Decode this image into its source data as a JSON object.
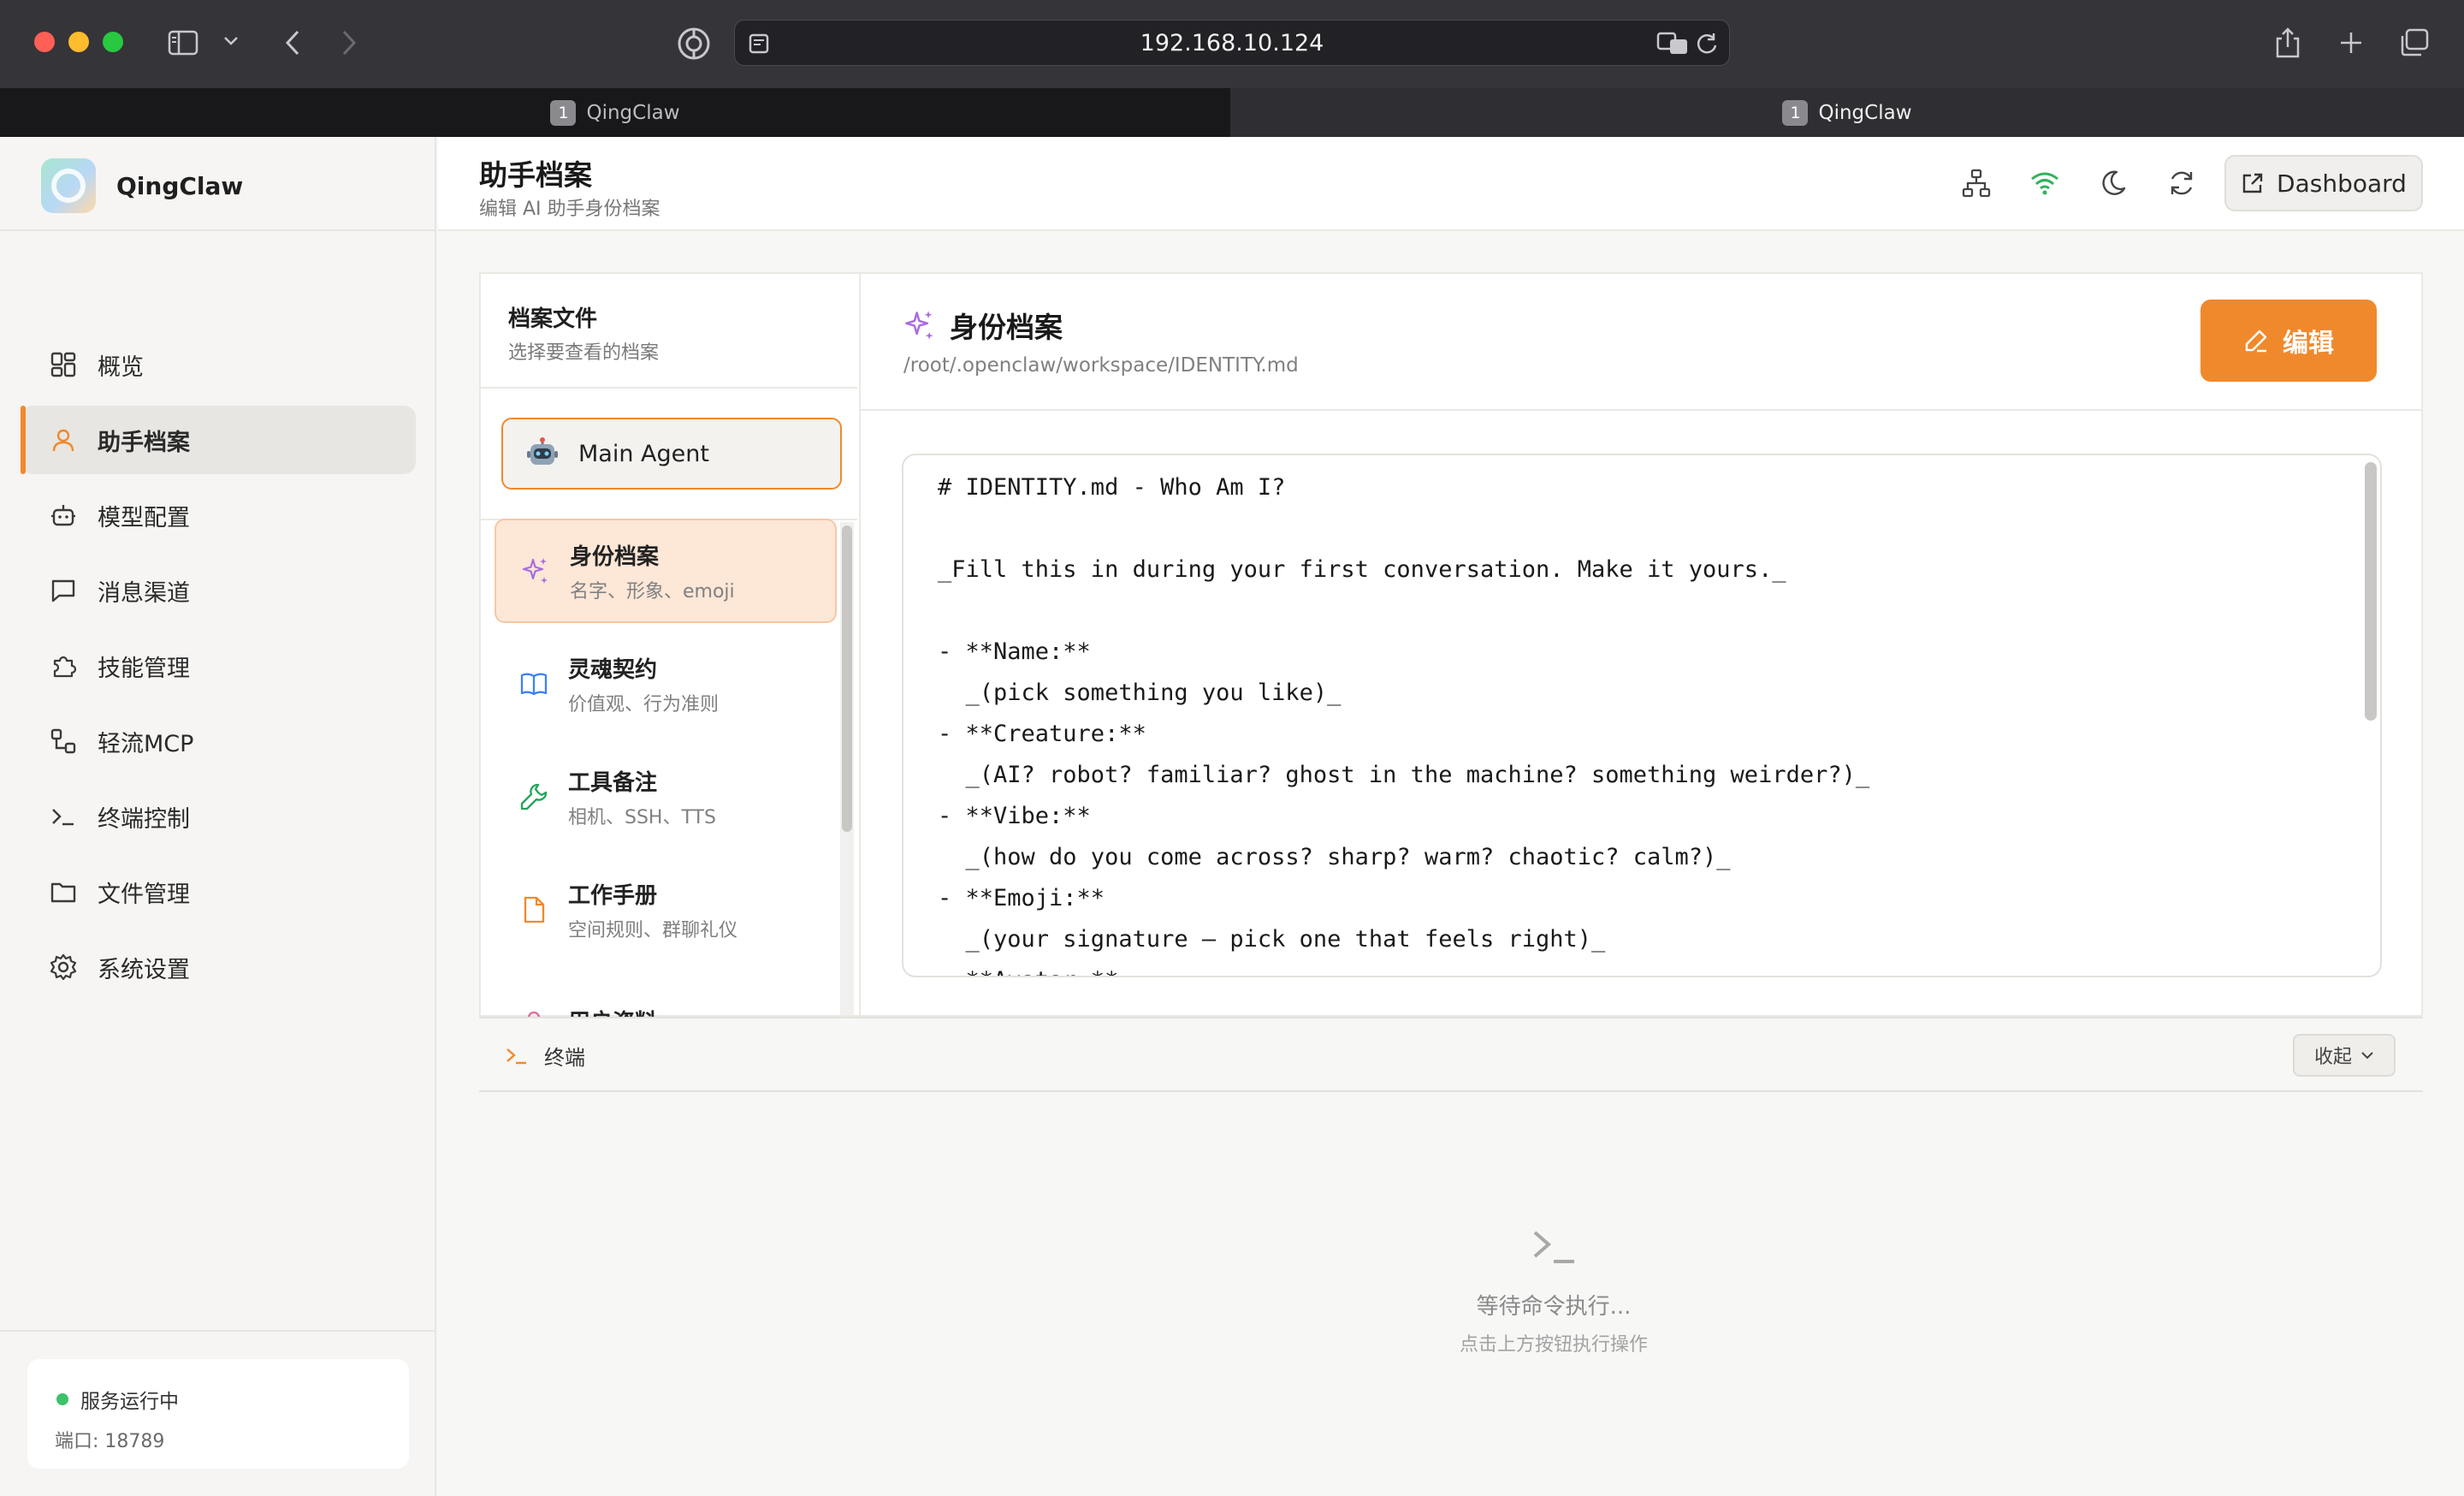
{
  "browser": {
    "address": "192.168.10.124",
    "tabs": [
      {
        "label": "QingClaw",
        "badge": "1"
      },
      {
        "label": "QingClaw",
        "badge": "1"
      }
    ]
  },
  "sidebar": {
    "brand": "QingClaw",
    "nav": [
      {
        "label": "概览",
        "icon": "grid-icon"
      },
      {
        "label": "助手档案",
        "icon": "user-icon",
        "active": true
      },
      {
        "label": "模型配置",
        "icon": "robot-icon"
      },
      {
        "label": "消息渠道",
        "icon": "message-icon"
      },
      {
        "label": "技能管理",
        "icon": "puzzle-icon"
      },
      {
        "label": "轻流MCP",
        "icon": "workflow-icon"
      },
      {
        "label": "终端控制",
        "icon": "terminal-icon"
      },
      {
        "label": "文件管理",
        "icon": "folder-icon"
      },
      {
        "label": "系统设置",
        "icon": "gear-icon"
      }
    ],
    "status": {
      "text": "服务运行中",
      "port": "端口: 18789",
      "color": "#3cc26a"
    }
  },
  "header": {
    "title": "助手档案",
    "subtitle": "编辑 AI 助手身份档案",
    "dashboard_label": "Dashboard"
  },
  "files_panel": {
    "title": "档案文件",
    "subtitle": "选择要查看的档案",
    "agent": "Main Agent",
    "items": [
      {
        "name": "身份档案",
        "desc": "名字、形象、emoji",
        "icon": "sparkles-icon",
        "active": true
      },
      {
        "name": "灵魂契约",
        "desc": "价值观、行为准则",
        "icon": "book-icon"
      },
      {
        "name": "工具备注",
        "desc": "相机、SSH、TTS",
        "icon": "wrench-icon"
      },
      {
        "name": "工作手册",
        "desc": "空间规则、群聊礼仪",
        "icon": "file-icon"
      },
      {
        "name": "用户资料",
        "desc": "",
        "icon": "user-file-icon"
      }
    ]
  },
  "editor": {
    "title": "身份档案",
    "path": "/root/.openclaw/workspace/IDENTITY.md",
    "edit_label": "编辑",
    "lines": [
      "# IDENTITY.md - Who Am I?",
      "",
      "_Fill this in during your first conversation. Make it yours._",
      "",
      "- **Name:**",
      "  _(pick something you like)_",
      "- **Creature:**",
      "  _(AI? robot? familiar? ghost in the machine? something weirder?)_",
      "- **Vibe:**",
      "  _(how do you come across? sharp? warm? chaotic? calm?)_",
      "- **Emoji:**",
      "  _(your signature — pick one that feels right)_",
      "- **Avatar:**"
    ]
  },
  "terminal": {
    "label": "终端",
    "collapse_label": "收起",
    "empty_title": "等待命令执行...",
    "empty_sub": "点击上方按钮执行操作"
  },
  "colors": {
    "accent": "#f0892c",
    "active_bg": "#fde7d7"
  }
}
